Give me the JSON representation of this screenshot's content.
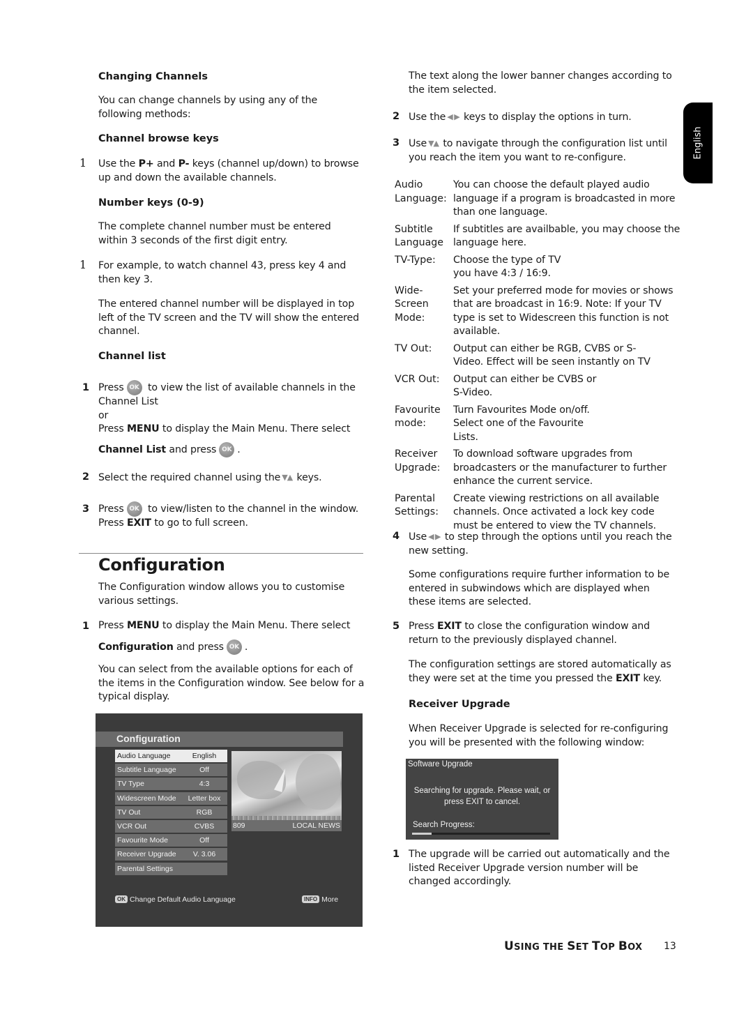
{
  "side_tab": {
    "label": "English"
  },
  "left": {
    "changing_channels": {
      "heading": "Changing Channels",
      "intro": "You can change channels by using any of the following methods:"
    },
    "browse_keys": {
      "heading": "Channel browse keys",
      "step_marker": "1",
      "text_1": "Use the ",
      "key_1": "P+",
      "text_2": " and ",
      "key_2": "P-",
      "text_3": " keys (channel up/down) to browse up and down the available channels."
    },
    "number_keys": {
      "heading": "Number keys (0-9)",
      "para_1": "The complete channel number must be entered within 3 seconds of the first digit entry.",
      "step_marker": "1",
      "step_text": "For example, to watch channel 43, press key 4 and then key 3.",
      "para_2": "The entered channel number will be displayed in top left of the TV screen and the TV will show the entered channel."
    },
    "channel_list": {
      "heading": "Channel list",
      "steps": [
        {
          "num": "1",
          "press": "Press",
          "after_ok": " to view the list of available channels in the Channel List",
          "or": "or",
          "menu_pre": "Press ",
          "menu_key": "MENU",
          "menu_post": " to display the Main Menu. There select",
          "select_bold": "Channel List",
          "select_post": " and press",
          "end": "."
        },
        {
          "num": "2",
          "pre": "Select the required channel using the",
          "post": " keys."
        },
        {
          "num": "3",
          "press": "Press",
          "after_ok": " to view/listen to the channel in the window.",
          "line2_pre": "Press ",
          "line2_key": "EXIT",
          "line2_post": " to go to full screen."
        }
      ]
    },
    "configuration": {
      "heading": "Configuration",
      "intro": "The Configuration window allows you to customise various settings.",
      "step_num": "1",
      "step_pre": "Press ",
      "step_key": "MENU",
      "step_post": " to display the Main Menu. There select",
      "select_bold": "Configuration",
      "select_post": " and press",
      "end": ".",
      "para": "You can select from the available options for each of the items in the Configuration window. See below for a typical display."
    }
  },
  "ok_button_label": "OK",
  "config_screen": {
    "title": "Configuration",
    "rows": [
      {
        "label": "Audio Language",
        "value": "English",
        "selected": true
      },
      {
        "label": "Subtitle Language",
        "value": "Off"
      },
      {
        "label": "TV Type",
        "value": "4:3"
      },
      {
        "label": "Widescreen Mode",
        "value": "Letter box"
      },
      {
        "label": "TV Out",
        "value": "RGB"
      },
      {
        "label": "VCR Out",
        "value": "CVBS"
      },
      {
        "label": "Favourite Mode",
        "value": "Off"
      },
      {
        "label": "Receiver Upgrade",
        "value": "V. 3.06"
      },
      {
        "label": "Parental Settings",
        "value": ""
      }
    ],
    "preview": {
      "channel_number": "809",
      "channel_name": "LOCAL NEWS"
    },
    "footer_left_key": "OK",
    "footer_left_text": "Change Default Audio Language",
    "footer_right_key": "INFO",
    "footer_right_text": "More"
  },
  "right": {
    "intro": "The text along the lower banner changes according to the item selected.",
    "step2": {
      "num": "2",
      "pre": "Use the",
      "post": " keys to display the options in turn."
    },
    "step3": {
      "num": "3",
      "pre": "Use",
      "post": " to navigate through the configuration list until you reach the item you want to re-configure."
    },
    "definitions": [
      {
        "term": "Audio Language:",
        "desc": "You can choose the default played audio language if a program is broadcasted in more than one language."
      },
      {
        "term": "Subtitle Language",
        "desc": "If subtitles are availbable, you may choose the language here."
      },
      {
        "term": "TV-Type:",
        "desc": "Choose the type of TV you have 4:3 / 16:9."
      },
      {
        "term": "Wide-Screen Mode:",
        "desc": "Set your preferred mode for movies or shows that are broadcast in 16:9. Note: If your TV type is set to Widescreen this function is not available."
      },
      {
        "term": "TV Out:",
        "desc": "Output can either be RGB, CVBS or S-Video. Effect will be seen instantly on TV"
      },
      {
        "term": "VCR Out:",
        "desc": "Output can either be CVBS or S-Video."
      },
      {
        "term": "Favourite mode:",
        "desc": "Turn Favourites Mode on/off. Select one of the Favourite Lists."
      },
      {
        "term": "Receiver Upgrade:",
        "desc": "To download software upgrades from broadcasters or the manufacturer to further enhance the current service."
      },
      {
        "term": "Parental Settings:",
        "desc": "Create viewing restrictions on all available channels. Once activated a lock key code must be entered to view the TV channels."
      }
    ],
    "step4": {
      "num": "4",
      "pre": "Use",
      "post": " to step through the options until you reach the new setting."
    },
    "subwindows_para": "Some configurations require further information to be entered in subwindows which are displayed when these items are selected.",
    "step5": {
      "num": "5",
      "pre": "Press ",
      "key": "EXIT",
      "post": " to close the configuration window and return to the previously displayed channel."
    },
    "stored_para": {
      "pre": "The configuration settings are stored automatically as they were set at the time you pressed the ",
      "key": "EXIT",
      "post": " key."
    },
    "receiver_upgrade": {
      "heading": "Receiver Upgrade",
      "intro": "When Receiver Upgrade is selected for re-configuring you will be presented with the following window:",
      "step_num": "1",
      "step_text": "The upgrade will be carried out automatically and the listed Receiver Upgrade version number will be changed accordingly."
    }
  },
  "upgrade_screen": {
    "title": "Software Upgrade",
    "message_line1": "Searching for upgrade. Please wait, or",
    "message_line2": "press EXIT to cancel.",
    "progress_label": "Search Progress:",
    "progress_fraction": 0.14
  },
  "footer": {
    "section_first": "U",
    "section_rest1": "SING THE ",
    "section_s": "S",
    "section_rest2": "ET ",
    "section_t": "T",
    "section_rest3": "OP ",
    "section_b": "B",
    "section_rest4": "OX",
    "page_number": "13"
  }
}
